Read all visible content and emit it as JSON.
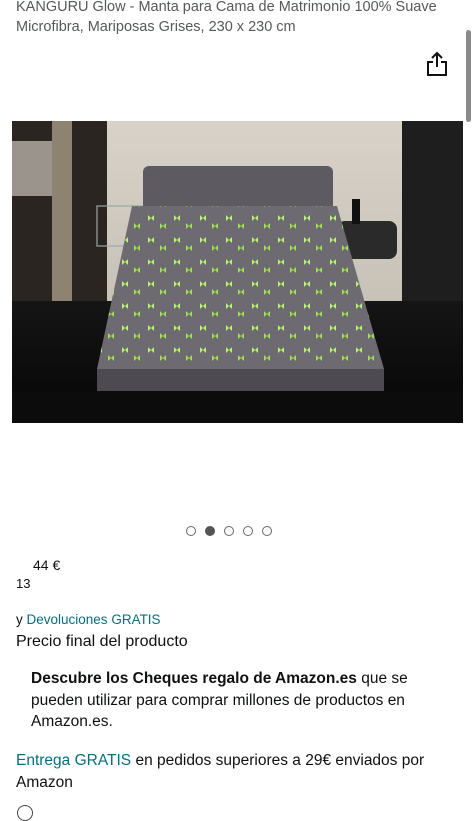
{
  "product": {
    "title": "KANGURU Glow - Manta para Cama de Matrimonio 100% Suave Microfibra, Mariposas Grises, 230 x 230 cm",
    "image_alt": "Manta gris con mariposas verdes sobre una cama"
  },
  "carousel": {
    "total": 5,
    "active_index": 1
  },
  "price": {
    "main": "44 €",
    "sub": "13"
  },
  "returns": {
    "prefix": "y ",
    "link": "Devoluciones GRATIS"
  },
  "final_price_label": "Precio final del producto",
  "promo": {
    "bold": "Descubre los Cheques regalo de Amazon.es",
    "rest": " que se pueden utilizar para comprar millones de productos en Amazon.es."
  },
  "delivery": {
    "link": "Entrega GRATIS",
    "rest": " en pedidos superiores a 29€ enviados por Amazon"
  },
  "icons": {
    "share": "share-icon"
  },
  "colors": {
    "link": "#007185",
    "text": "#0f1111",
    "muted": "#565959"
  }
}
